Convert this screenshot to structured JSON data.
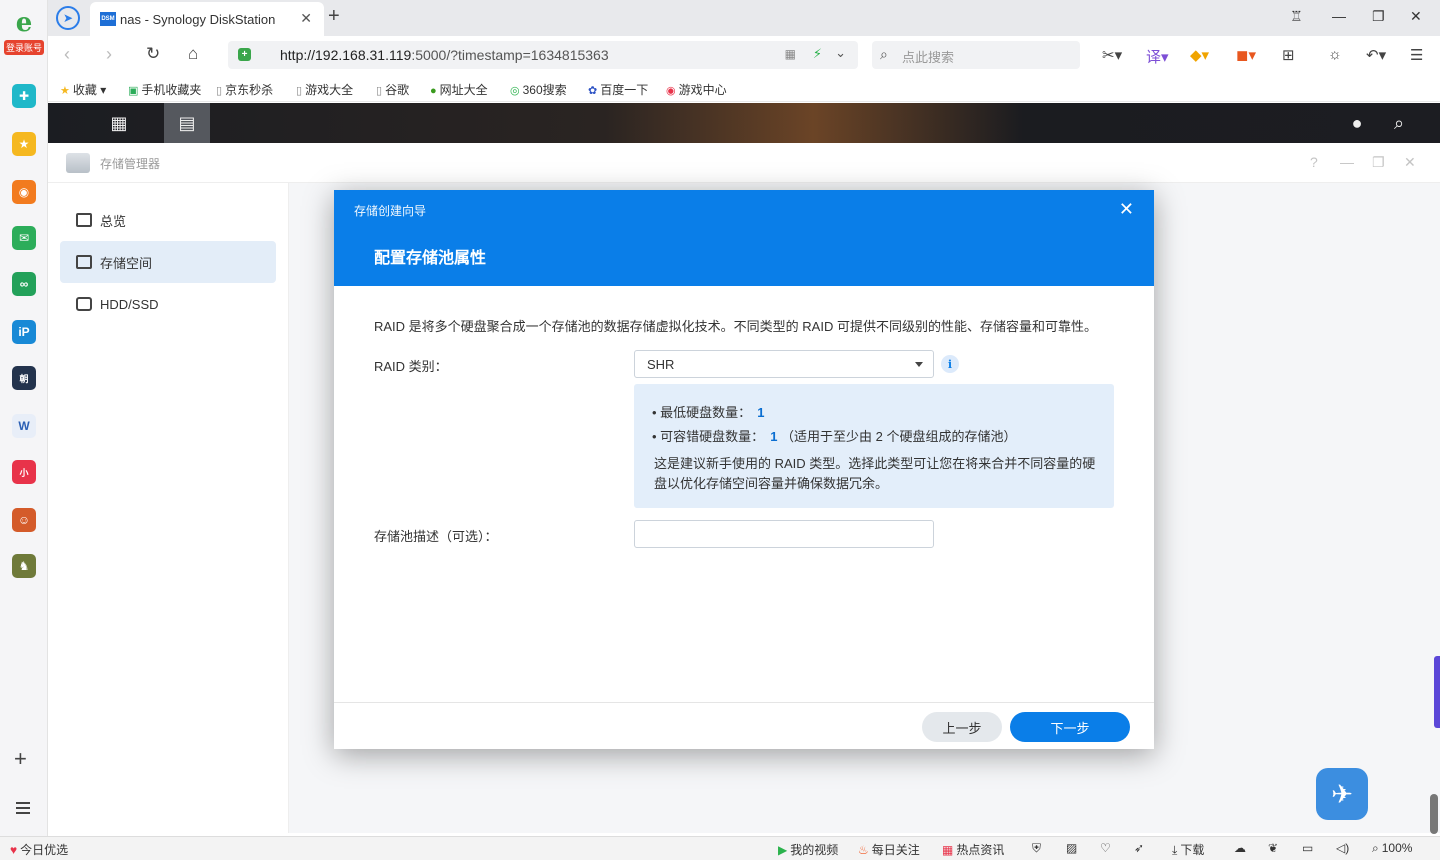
{
  "sidebar": {
    "logo_badge": "登录账号",
    "apps": [
      {
        "name": "plus-app",
        "color": "#1fb8c9",
        "glyph": "✚"
      },
      {
        "name": "star-app",
        "color": "#f5b820",
        "glyph": "★"
      },
      {
        "name": "weibo-app",
        "color": "#f27b1f",
        "glyph": "◉"
      },
      {
        "name": "mail-app",
        "color": "#2cad5a",
        "glyph": "✉"
      },
      {
        "name": "link-app",
        "color": "#23a15a",
        "glyph": "∞"
      },
      {
        "name": "ip-app",
        "color": "#1889d6",
        "glyph": "iP"
      },
      {
        "name": "news-app",
        "color": "#23334d",
        "glyph": "朝"
      },
      {
        "name": "word-app",
        "color": "#e8eef8",
        "glyph": "W"
      },
      {
        "name": "redbook-app",
        "color": "#e8334a",
        "glyph": "小"
      },
      {
        "name": "game1-app",
        "color": "#d45b2a",
        "glyph": "☺"
      },
      {
        "name": "game2-app",
        "color": "#6f7a3a",
        "glyph": "♞"
      }
    ]
  },
  "browser": {
    "tab_title": "nas - Synology DiskStation",
    "tab_favicon": "DSM",
    "url_host": "http://192.168.31.119",
    "url_rest": ":5000/?timestamp=1634815363",
    "search_placeholder": "点此搜索"
  },
  "bookmarks": [
    {
      "label": "收藏",
      "icon": "★"
    },
    {
      "label": "手机收藏夹",
      "icon": "▣"
    },
    {
      "label": "京东秒杀",
      "icon": "▯"
    },
    {
      "label": "游戏大全",
      "icon": "▯"
    },
    {
      "label": "谷歌",
      "icon": "▯"
    },
    {
      "label": "网址大全",
      "icon": "●"
    },
    {
      "label": "360搜索",
      "icon": "◎"
    },
    {
      "label": "百度一下",
      "icon": "✿"
    },
    {
      "label": "游戏中心",
      "icon": "◉"
    }
  ],
  "storage_manager": {
    "title": "存储管理器",
    "nav": [
      {
        "label": "总览"
      },
      {
        "label": "存储空间"
      },
      {
        "label": "HDD/SSD"
      }
    ]
  },
  "wizard": {
    "subtitle": "存储创建向导",
    "title": "配置存储池属性",
    "description": "RAID 是将多个硬盘聚合成一个存储池的数据存储虚拟化技术。不同类型的 RAID 可提供不同级别的性能、存储容量和可靠性。",
    "raid_label": "RAID 类别：",
    "raid_value": "SHR",
    "info": {
      "min_disks_label": "最低硬盘数量：",
      "min_disks_value": "1",
      "fault_label": "可容错硬盘数量：",
      "fault_value": "1",
      "fault_note": "（适用于至少由 2 个硬盘组成的存储池）",
      "text": "这是建议新手使用的 RAID 类型。选择此类型可让您在将来合并不同容量的硬盘以优化存储空间容量并确保数据冗余。"
    },
    "desc_label": "存储池描述（可选）：",
    "desc_value": "",
    "prev_button": "上一步",
    "next_button": "下一步"
  },
  "statusbar": {
    "left": "今日优选",
    "items": [
      "我的视频",
      "每日关注",
      "热点资讯",
      "下载"
    ],
    "zoom": "100%"
  },
  "colors": {
    "accent": "#0a7ee8",
    "nav_active": "#e3edf8",
    "info_bg": "#e3eefa"
  }
}
